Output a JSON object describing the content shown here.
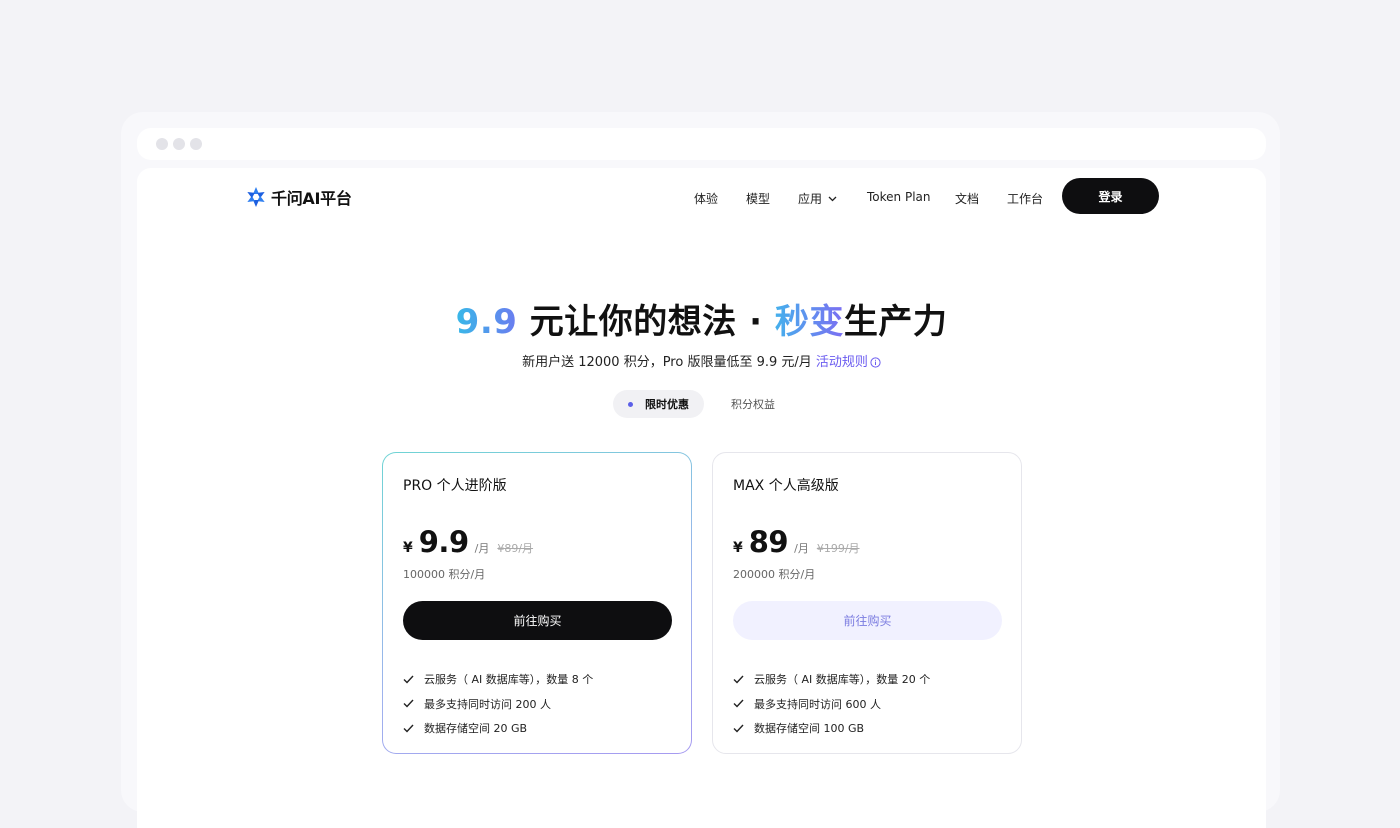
{
  "brand": {
    "name": "千问AI平台"
  },
  "nav": {
    "items": [
      {
        "label": "体验"
      },
      {
        "label": "模型"
      },
      {
        "label": "应用",
        "has_dropdown": true
      },
      {
        "label": "Token Plan"
      },
      {
        "label": "文档"
      },
      {
        "label": "工作台"
      }
    ],
    "login_label": "登录"
  },
  "hero": {
    "title_price": "9.9",
    "title_mid": " 元让你的想法 · ",
    "title_highlight": "秒变",
    "title_end": "生产力",
    "subtitle": "新用户送 12000 积分，Pro 版限量低至 9.9 元/月 ",
    "rules_link": "活动规则"
  },
  "tabs": [
    {
      "label": "限时优惠",
      "active": true
    },
    {
      "label": "积分权益",
      "active": false
    }
  ],
  "plans": [
    {
      "title": "PRO 个人进阶版",
      "currency": "¥",
      "price": "9.9",
      "per": "/月",
      "original": "¥89/月",
      "points": "100000 积分/月",
      "button": "前往购买",
      "features": [
        "云服务（ AI 数据库等），数量 8 个",
        "最多支持同时访问 200 人",
        "数据存储空间 20 GB"
      ]
    },
    {
      "title": "MAX 个人高级版",
      "currency": "¥",
      "price": "89",
      "per": "/月",
      "original": "¥199/月",
      "points": "200000 积分/月",
      "button": "前往购买",
      "features": [
        "云服务（ AI 数据库等），数量 20 个",
        "最多支持同时访问 600 人",
        "数据存储空间 100 GB"
      ]
    }
  ],
  "colors": {
    "accent": "#6b5cf0",
    "primary_button": "#0e0e10",
    "secondary_button": "#f1f1ff"
  }
}
